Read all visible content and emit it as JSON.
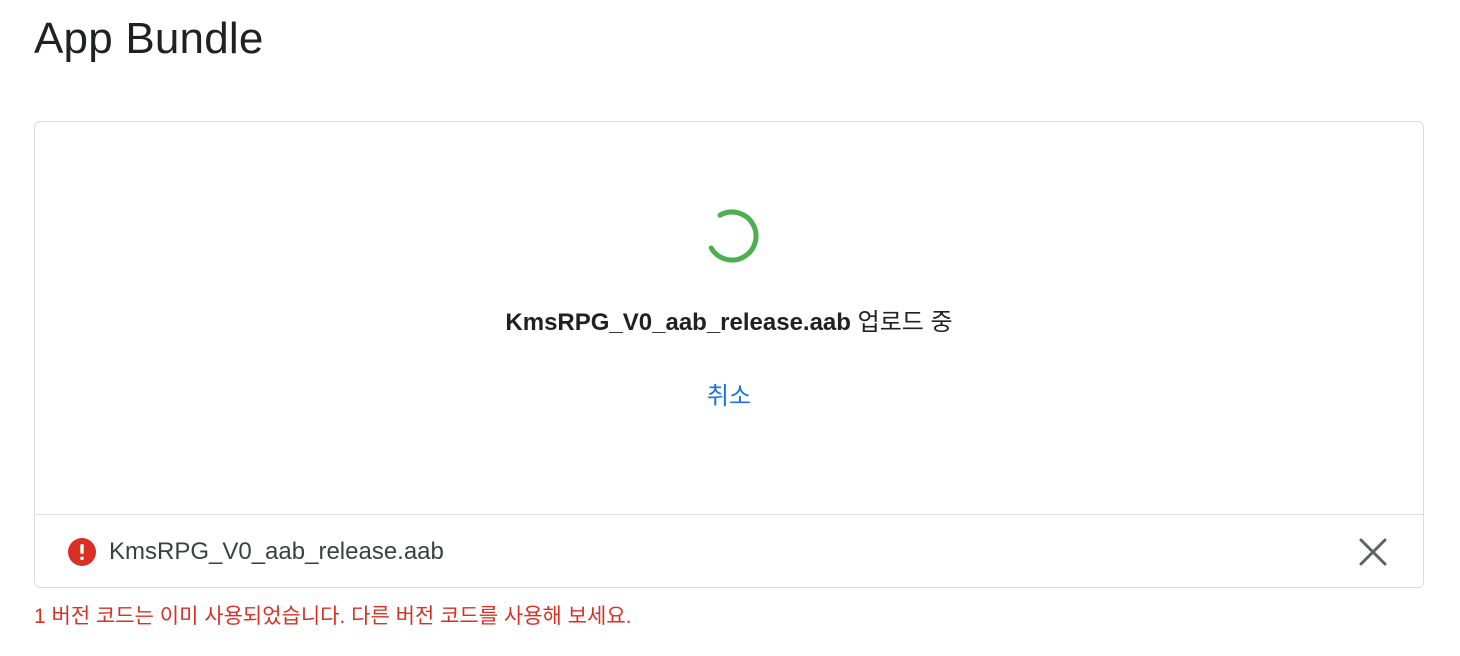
{
  "page": {
    "title": "App Bundle"
  },
  "upload": {
    "filename": "KmsRPG_V0_aab_release.aab",
    "status_suffix": " 업로드 중",
    "cancel_label": "취소"
  },
  "file_row": {
    "filename": "KmsRPG_V0_aab_release.aab",
    "status_icon": "error-icon",
    "remove_icon": "close-icon"
  },
  "error": {
    "message": "1 버전 코드는 이미 사용되었습니다. 다른 버전 코드를 사용해 보세요."
  },
  "colors": {
    "spinner": "#4caf50",
    "link": "#1a73e8",
    "error": "#d93025"
  }
}
